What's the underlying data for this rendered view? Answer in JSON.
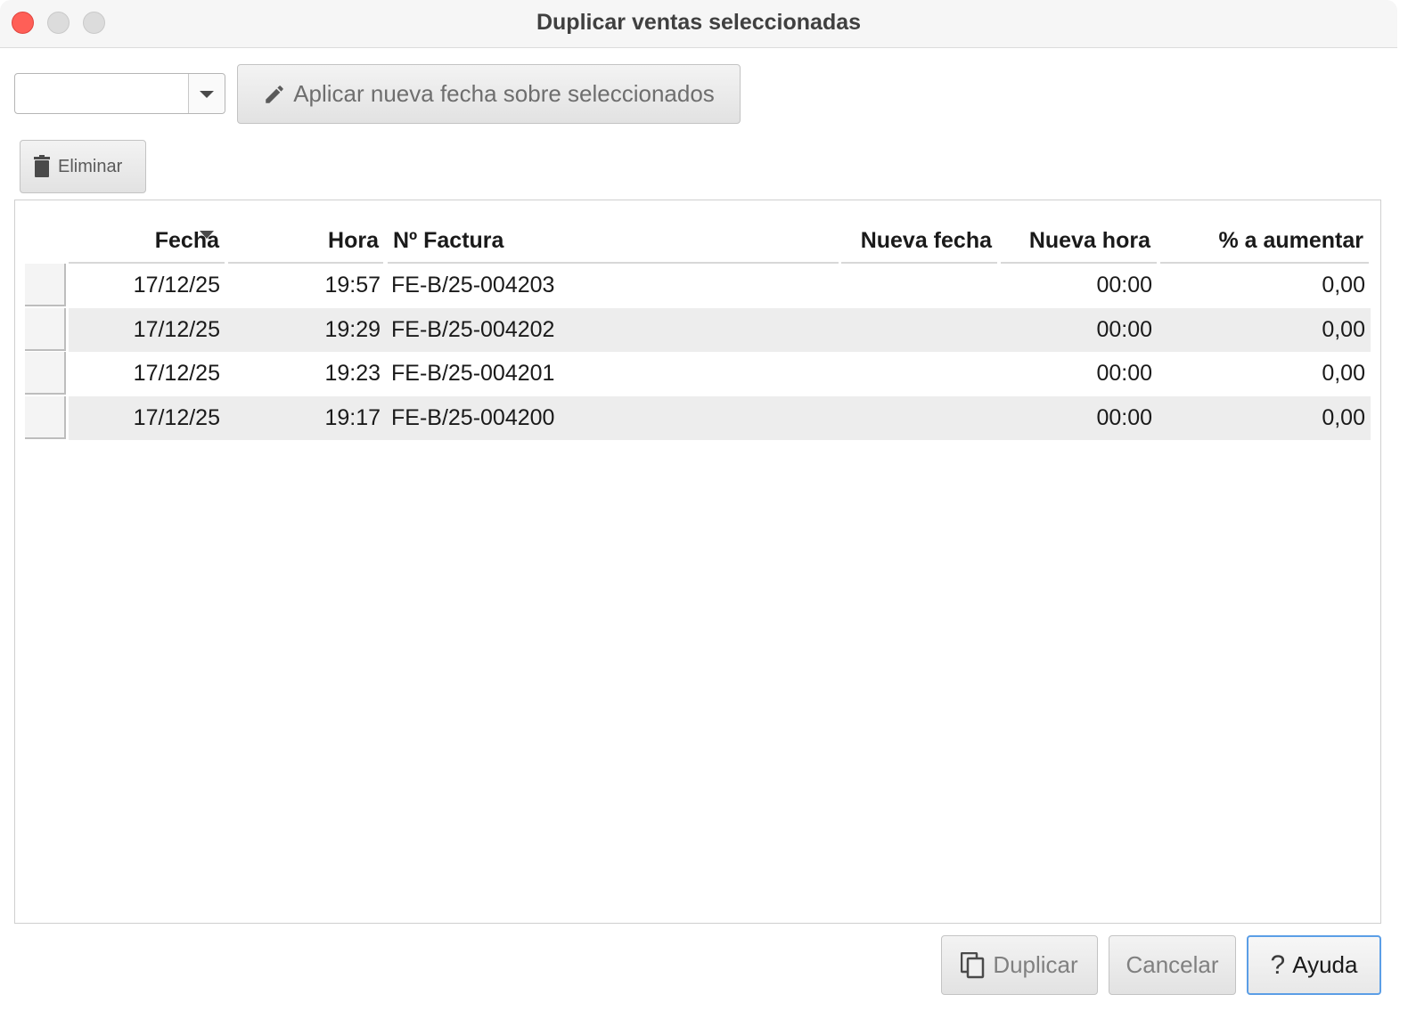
{
  "window": {
    "title": "Duplicar ventas seleccionadas"
  },
  "toolbar": {
    "date_value": "",
    "apply_label": "Aplicar nueva fecha sobre seleccionados",
    "delete_label": "Eliminar"
  },
  "table": {
    "columns": [
      "Fecha",
      "Hora",
      "Nº Factura",
      "Nueva fecha",
      "Nueva hora",
      "% a aumentar"
    ],
    "sorted_column": "Fecha",
    "rows": [
      {
        "fecha": "17/12/25",
        "hora": "19:57",
        "factura": "FE-B/25-004203",
        "nueva_fecha": "",
        "nueva_hora": "00:00",
        "aumentar": "0,00"
      },
      {
        "fecha": "17/12/25",
        "hora": "19:29",
        "factura": "FE-B/25-004202",
        "nueva_fecha": "",
        "nueva_hora": "00:00",
        "aumentar": "0,00"
      },
      {
        "fecha": "17/12/25",
        "hora": "19:23",
        "factura": "FE-B/25-004201",
        "nueva_fecha": "",
        "nueva_hora": "00:00",
        "aumentar": "0,00"
      },
      {
        "fecha": "17/12/25",
        "hora": "19:17",
        "factura": "FE-B/25-004200",
        "nueva_fecha": "",
        "nueva_hora": "00:00",
        "aumentar": "0,00"
      }
    ]
  },
  "footer": {
    "duplicar_label": "Duplicar",
    "cancelar_label": "Cancelar",
    "ayuda_label": "Ayuda",
    "ayuda_icon": "?"
  },
  "colors": {
    "close": "#ff5f57",
    "row_alt": "#ededed",
    "focus": "#5b9ee6"
  },
  "icons": {
    "apply": "pencil-icon",
    "delete": "trash-icon",
    "duplicate": "copy-icon",
    "help": "question-icon",
    "combo": "chevron-down-icon",
    "sort": "sort-desc-icon"
  }
}
